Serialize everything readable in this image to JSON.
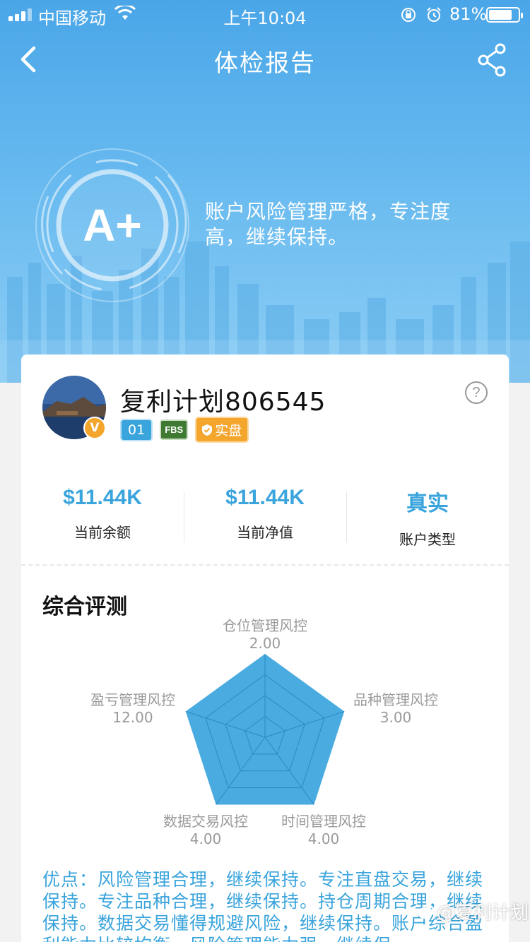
{
  "status_bar": {
    "carrier": "中国移动",
    "time": "上午10:04",
    "battery": "81%"
  },
  "nav": {
    "title": "体检报告",
    "back_icon": "chevron-left-icon",
    "share_icon": "share-icon"
  },
  "hero": {
    "grade": "A+",
    "summary": "账户风险管理严格，专注度高，继续保持。"
  },
  "account": {
    "name": "复利计划806545",
    "tags": {
      "number": "01",
      "broker": "FBS",
      "type": "实盘"
    },
    "help_icon": "question-mark-icon"
  },
  "stats": [
    {
      "value": "$11.44K",
      "label": "当前余额"
    },
    {
      "value": "$11.44K",
      "label": "当前净值"
    },
    {
      "value": "真实",
      "label": "账户类型"
    }
  ],
  "evaluation": {
    "title": "综合评测",
    "dimensions": [
      {
        "name": "仓位管理风控",
        "score": "2.00"
      },
      {
        "name": "品种管理风控",
        "score": "3.00"
      },
      {
        "name": "时间管理风控",
        "score": "4.00"
      },
      {
        "name": "数据交易风控",
        "score": "4.00"
      },
      {
        "name": "盈亏管理风控",
        "score": "12.00"
      }
    ],
    "pros": "优点：风险管理合理，继续保持。专注直盘交易，继续保持。专注品种合理，继续保持。持仓周期合理，继续保持。数据交易懂得规避风险，继续保持。账户综合盈利能力比较均衡，风险管理能力强，继续保"
  },
  "watermark": "@复利计划",
  "colors": {
    "accent": "#3aa4dc",
    "radar_fill": "#3aa4dc",
    "badge_orange": "#f3a52c"
  }
}
